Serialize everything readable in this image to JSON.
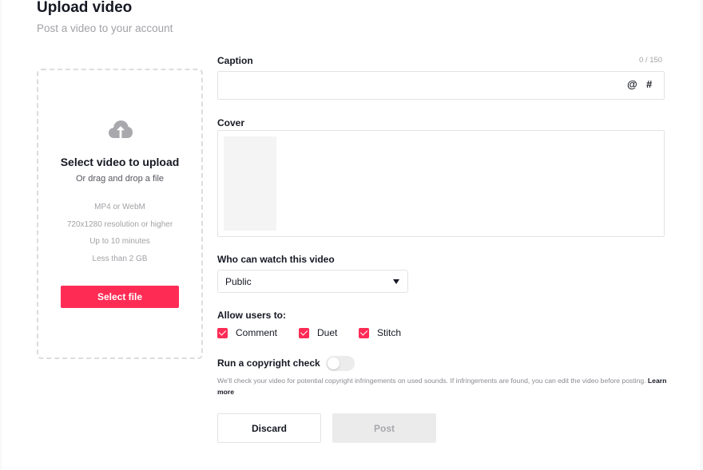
{
  "header": {
    "title": "Upload video",
    "subtitle": "Post a video to your account"
  },
  "uploader": {
    "icon": "cloud-upload-icon",
    "title": "Select video to upload",
    "subtitle": "Or drag and drop a file",
    "specs": [
      "MP4 or WebM",
      "720x1280 resolution or higher",
      "Up to 10 minutes",
      "Less than 2 GB"
    ],
    "button_label": "Select file"
  },
  "caption": {
    "label": "Caption",
    "counter": "0 / 150",
    "value": "",
    "mention_icon": "@",
    "hashtag_icon": "#"
  },
  "cover": {
    "label": "Cover"
  },
  "privacy": {
    "label": "Who can watch this video",
    "selected": "Public"
  },
  "allow": {
    "label": "Allow users to:",
    "options": [
      {
        "label": "Comment",
        "checked": true
      },
      {
        "label": "Duet",
        "checked": true
      },
      {
        "label": "Stitch",
        "checked": true
      }
    ]
  },
  "copyright": {
    "label": "Run a copyright check",
    "enabled": false,
    "note": "We'll check your video for potential copyright infringements on used sounds. If infringements are found, you can edit the video before posting.",
    "learn_more": "Learn more"
  },
  "actions": {
    "discard_label": "Discard",
    "post_label": "Post"
  },
  "colors": {
    "accent": "#fe2c55",
    "text": "#161823",
    "muted": "#a2a2a7"
  }
}
